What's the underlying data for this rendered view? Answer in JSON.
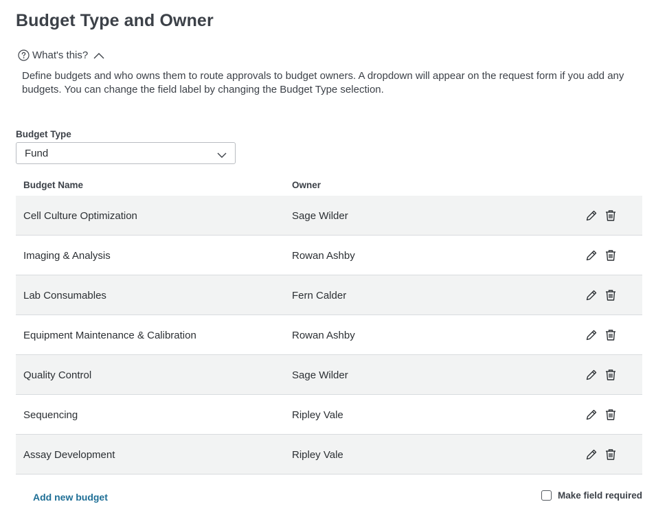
{
  "page": {
    "title": "Budget Type and Owner"
  },
  "help": {
    "toggle_label": "What's this?",
    "icon": "question-circle-icon",
    "text": "Define budgets and who owns them to route approvals to budget owners. A dropdown will appear on the request form if you add any budgets. You can change the field label by changing the Budget Type selection."
  },
  "budget_type": {
    "label": "Budget Type",
    "selected": "Fund"
  },
  "table": {
    "columns": [
      "Budget Name",
      "Owner"
    ],
    "rows": [
      {
        "name": "Cell Culture Optimization",
        "owner": "Sage Wilder"
      },
      {
        "name": "Imaging & Analysis",
        "owner": "Rowan Ashby"
      },
      {
        "name": "Lab Consumables",
        "owner": "Fern Calder"
      },
      {
        "name": "Equipment Maintenance & Calibration",
        "owner": "Rowan Ashby"
      },
      {
        "name": "Quality Control",
        "owner": "Sage Wilder"
      },
      {
        "name": "Sequencing",
        "owner": "Ripley Vale"
      },
      {
        "name": "Assay Development",
        "owner": "Ripley Vale"
      }
    ]
  },
  "footer": {
    "add_label": "Add new budget",
    "required_label": "Make field required",
    "required_checked": false
  },
  "colors": {
    "link": "#1f6f96",
    "row_stripe": "#f2f3f3",
    "text": "#2b2f33"
  }
}
